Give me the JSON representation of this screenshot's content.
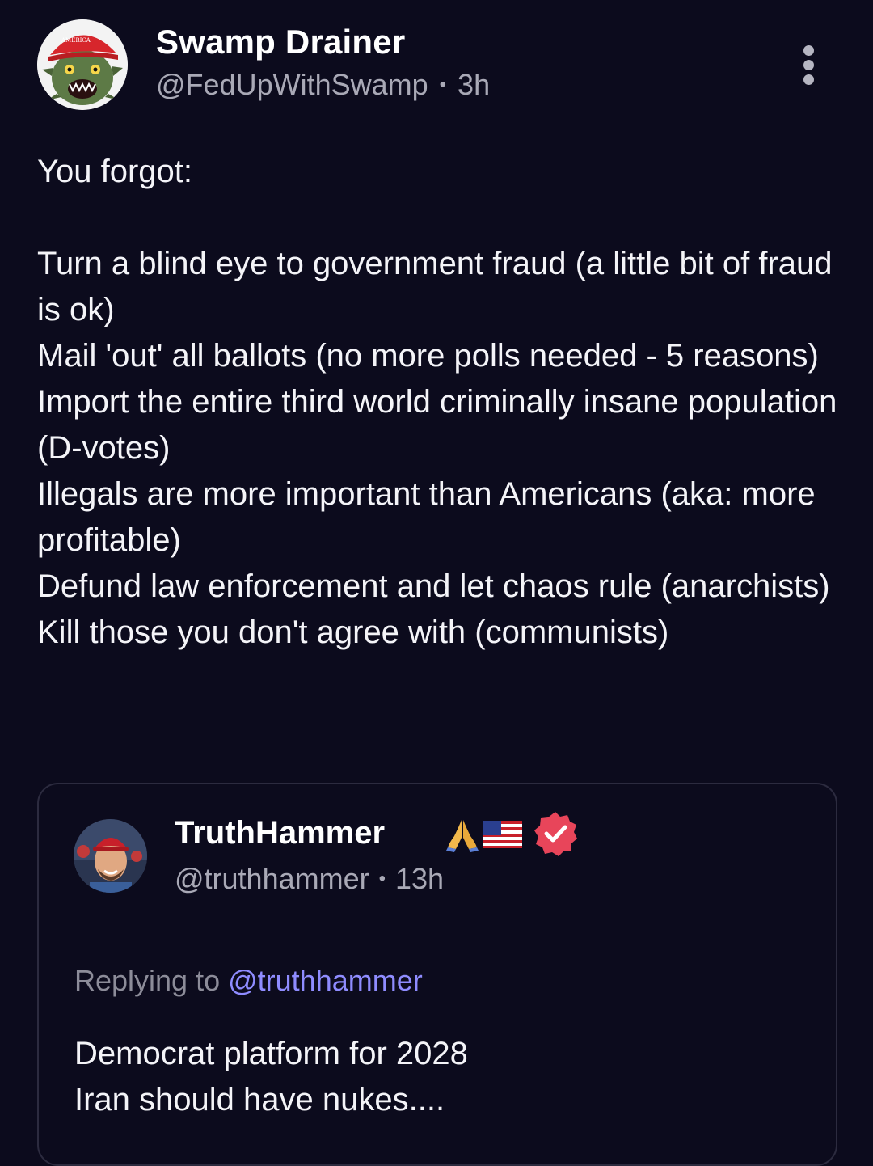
{
  "post": {
    "display_name": "Swamp Drainer",
    "handle": "@FedUpWithSwamp",
    "separator": "•",
    "time": "3h",
    "more_icon": "more-vertical-icon",
    "avatar_icon": "maga-monster-avatar",
    "body": {
      "intro": "You forgot:",
      "lines": [
        "Turn a blind eye to government fraud (a little bit of fraud is ok)",
        "Mail 'out' all ballots (no more polls needed - 5 reasons)",
        "Import the entire third world criminally insane population (D-votes)",
        "Illegals are more important than Americans (aka: more profitable)",
        "Defund law enforcement and let chaos rule (anarchists)",
        "Kill those you don't agree with (communists)"
      ]
    }
  },
  "quoted": {
    "display_name": "TruthHammer",
    "emoji_icons": [
      "praying-hands-icon",
      "us-flag-icon"
    ],
    "verified_icon": "verified-badge-icon",
    "handle": "@truthhammer",
    "separator": "•",
    "time": "13h",
    "replying_label": "Replying to",
    "replying_mention": "@truthhammer",
    "body": [
      "Democrat platform for 2028",
      "Iran should have nukes...."
    ]
  },
  "colors": {
    "background": "#0c0b1d",
    "text": "#f4f4f8",
    "muted": "#a9a9b6",
    "mention": "#8f8cff",
    "verified": "#e8455a",
    "card_border": "#2c2b3f"
  }
}
